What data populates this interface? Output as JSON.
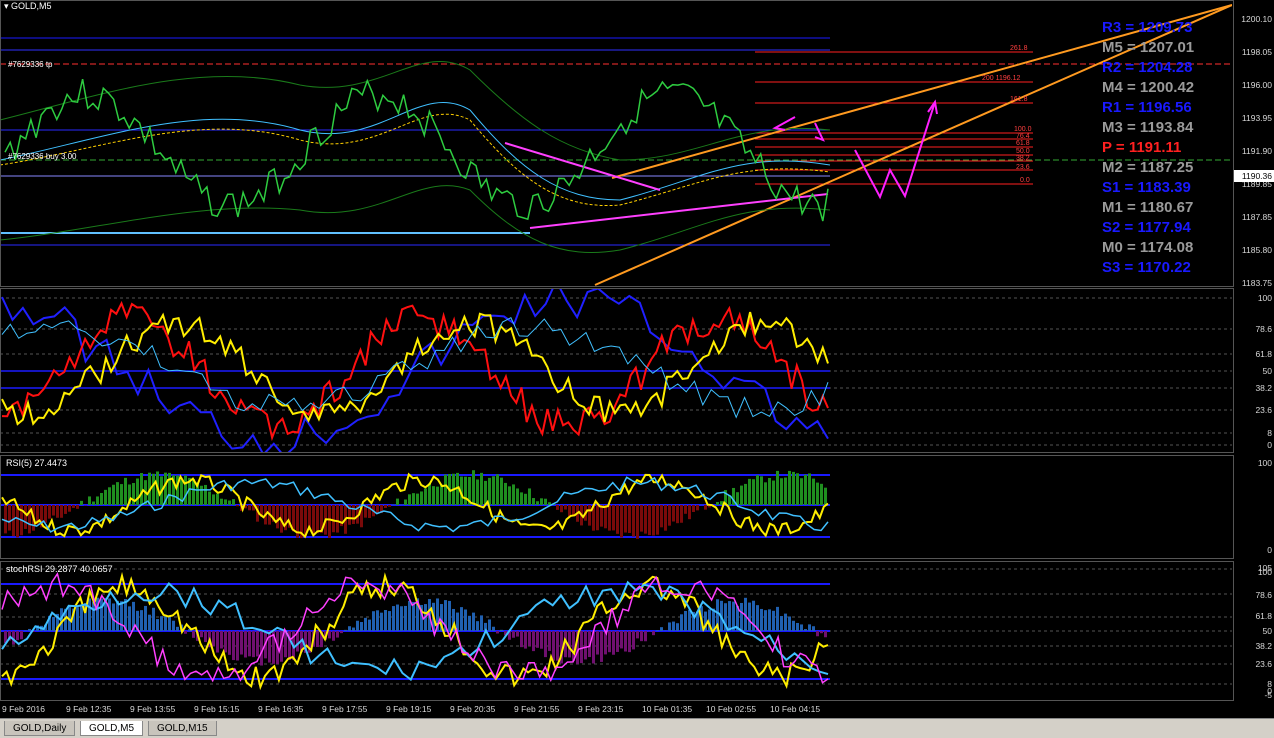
{
  "chart": {
    "title": "GOLD,M5",
    "order_tp_label": "#7629336 tp",
    "order_buy_label": "#7629336 buy 3.00",
    "current_price": "1190.36",
    "price_ticks": [
      "1200.10",
      "1198.05",
      "1196.00",
      "1193.95",
      "1191.90",
      "1189.85",
      "1187.85",
      "1185.80",
      "1183.75"
    ],
    "fib_labels": [
      "261.8",
      "200 1196.12",
      "161.8",
      "100.0",
      "76.4",
      "61.8",
      "50.0",
      "38.2",
      "23.6",
      "0.0"
    ],
    "pivots": [
      {
        "label": "R3 = 1209.73",
        "color": "#1a1aff"
      },
      {
        "label": "M5 = 1207.01",
        "color": "#9a9a9a"
      },
      {
        "label": "R2 = 1204.28",
        "color": "#1a1aff"
      },
      {
        "label": "M4 = 1200.42",
        "color": "#9a9a9a"
      },
      {
        "label": "R1 = 1196.56",
        "color": "#1a1aff"
      },
      {
        "label": "M3 = 1193.84",
        "color": "#9a9a9a"
      },
      {
        "label": "P  = 1191.11",
        "color": "#ff2020"
      },
      {
        "label": "M2 = 1187.25",
        "color": "#9a9a9a"
      },
      {
        "label": "S1 = 1183.39",
        "color": "#1a1aff"
      },
      {
        "label": "M1 = 1180.67",
        "color": "#9a9a9a"
      },
      {
        "label": "S2 = 1177.94",
        "color": "#1a1aff"
      },
      {
        "label": "M0 = 1174.08",
        "color": "#9a9a9a"
      },
      {
        "label": "S3 = 1170.22",
        "color": "#1a1aff"
      }
    ]
  },
  "indicator1": {
    "ticks": [
      "100",
      "78.6",
      "61.8",
      "50",
      "38.2",
      "23.6",
      "8",
      "0"
    ]
  },
  "indicator2": {
    "label": "RSI(5) 27.4473",
    "ticks": [
      "100",
      "0"
    ]
  },
  "indicator3": {
    "label": "stochRSI 29.2877 40.0657",
    "ticks": [
      "105",
      "100",
      "78.6",
      "61.8",
      "50",
      "38.2",
      "23.6",
      "8",
      "0",
      "-5"
    ]
  },
  "time_axis": [
    "9 Feb 2016",
    "9 Feb 12:35",
    "9 Feb 13:55",
    "9 Feb 15:15",
    "9 Feb 16:35",
    "9 Feb 17:55",
    "9 Feb 19:15",
    "9 Feb 20:35",
    "9 Feb 21:55",
    "9 Feb 23:15",
    "10 Feb 01:35",
    "10 Feb 02:55",
    "10 Feb 04:15"
  ],
  "tabs": [
    "GOLD,Daily",
    "GOLD,M5",
    "GOLD,M15"
  ],
  "active_tab": 1
}
